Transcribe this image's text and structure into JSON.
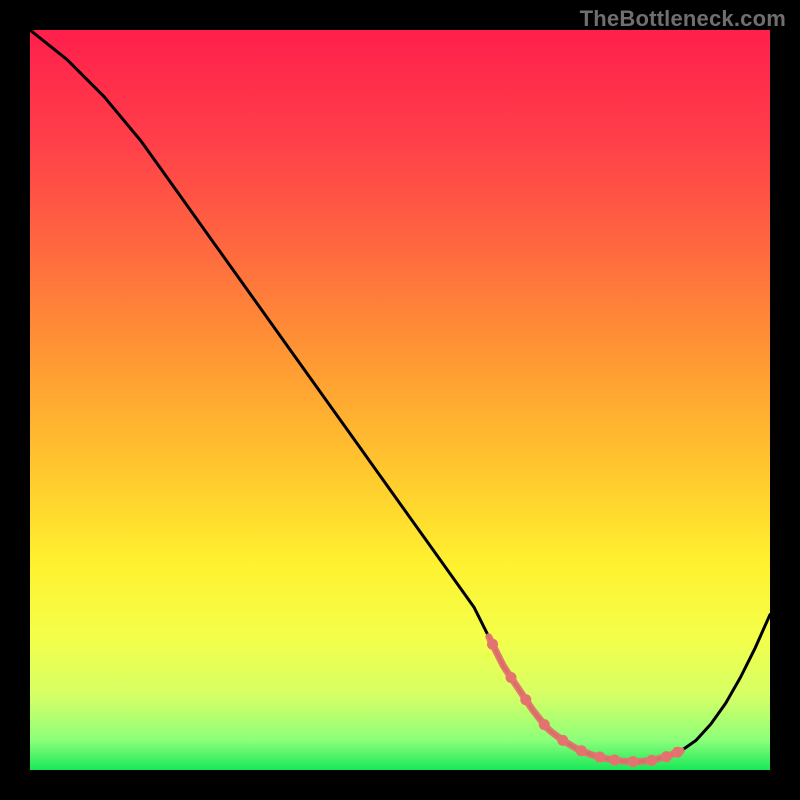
{
  "watermark": "TheBottleneck.com",
  "chart_data": {
    "type": "line",
    "title": "",
    "xlabel": "",
    "ylabel": "",
    "xlim": [
      0,
      100
    ],
    "ylim": [
      0,
      100
    ],
    "x": [
      0,
      5,
      10,
      15,
      20,
      25,
      30,
      35,
      40,
      45,
      50,
      55,
      60,
      62,
      64,
      66,
      68,
      70,
      72,
      74,
      76,
      78,
      80,
      82,
      84,
      86,
      88,
      90,
      92,
      94,
      96,
      98,
      100
    ],
    "values": [
      100,
      96,
      91,
      85,
      78,
      71,
      64,
      57,
      50,
      43,
      36,
      29,
      22,
      18,
      14,
      11,
      8,
      5.5,
      4,
      2.8,
      2.0,
      1.5,
      1.2,
      1.1,
      1.3,
      1.8,
      2.6,
      4.0,
      6.2,
      9.0,
      12.5,
      16.5,
      21
    ],
    "optimal_band": {
      "x_start": 62,
      "x_end": 88
    },
    "optimal_dots_x": [
      62.5,
      65,
      67,
      69.5,
      72,
      74.5,
      77,
      79,
      81.5,
      84,
      86,
      87.5
    ],
    "gradient_stops": [
      {
        "offset": 0.0,
        "color": "#ff1f4b"
      },
      {
        "offset": 0.15,
        "color": "#ff3f4a"
      },
      {
        "offset": 0.3,
        "color": "#ff6a3f"
      },
      {
        "offset": 0.45,
        "color": "#ff9a33"
      },
      {
        "offset": 0.6,
        "color": "#ffc92e"
      },
      {
        "offset": 0.72,
        "color": "#fff12f"
      },
      {
        "offset": 0.82,
        "color": "#f4ff4a"
      },
      {
        "offset": 0.9,
        "color": "#d5ff66"
      },
      {
        "offset": 0.96,
        "color": "#8cff7a"
      },
      {
        "offset": 1.0,
        "color": "#17e858"
      }
    ],
    "curve_color": "#000000",
    "dot_color": "#e4736f"
  }
}
